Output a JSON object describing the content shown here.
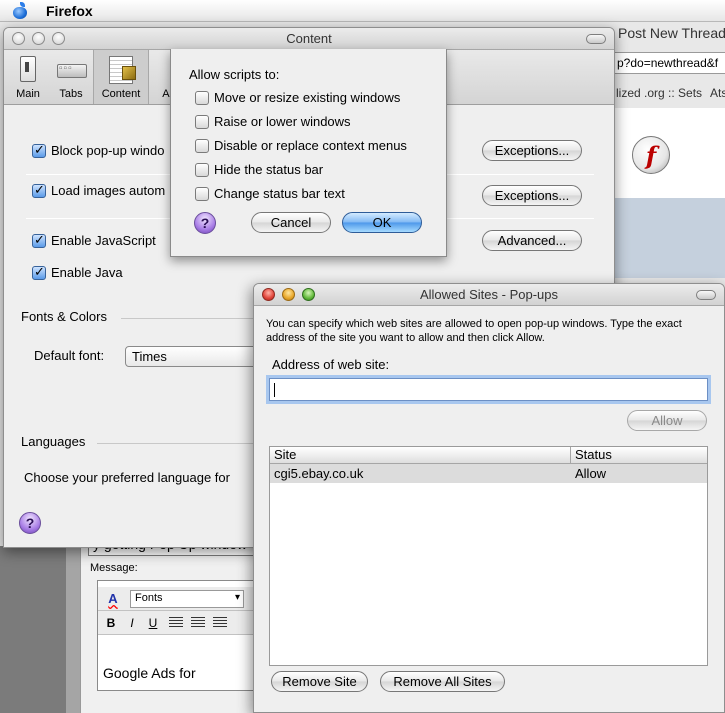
{
  "menubar": {
    "app_name": "Firefox"
  },
  "browser": {
    "title": "Post New Thread",
    "url": "p?do=newthread&f",
    "bookmarks": [
      "lized .org :: Sets",
      "Ats"
    ],
    "subject_value": "y getting Pop Up window",
    "message_label": "Message:",
    "editor": {
      "font_select": "Fonts",
      "bold": "B",
      "italic": "I",
      "underline": "U",
      "text": "Google Ads for"
    }
  },
  "prefs": {
    "title": "Content",
    "toolbar": [
      {
        "label": "Main",
        "icon": "main-switch-icon"
      },
      {
        "label": "Tabs",
        "icon": "tabs-icon"
      },
      {
        "label": "Content",
        "icon": "content-icon"
      },
      {
        "label": "Ap",
        "icon": "applications-icon"
      }
    ],
    "checks": {
      "block_popups": "Block pop-up windo",
      "load_images": "Load images autom",
      "enable_js": "Enable JavaScript",
      "enable_java": "Enable Java"
    },
    "buttons": {
      "exceptions1": "Exceptions...",
      "exceptions2": "Exceptions...",
      "advanced": "Advanced..."
    },
    "fonts_section": "Fonts & Colors",
    "default_font_label": "Default font:",
    "default_font_value": "Times",
    "languages_section": "Languages",
    "languages_desc": "Choose your preferred language for",
    "help": "?"
  },
  "scripts_sheet": {
    "heading": "Allow scripts to:",
    "options": [
      {
        "label": "Move or resize existing windows",
        "checked": false
      },
      {
        "label": "Raise or lower windows",
        "checked": false
      },
      {
        "label": "Disable or replace context menus",
        "checked": false
      },
      {
        "label": "Hide the status bar",
        "checked": false
      },
      {
        "label": "Change status bar text",
        "checked": false
      }
    ],
    "help": "?",
    "cancel": "Cancel",
    "ok": "OK"
  },
  "allowed_sites": {
    "title": "Allowed Sites - Pop-ups",
    "description": "You can specify which web sites are allowed to open pop-up windows. Type the exact address of the site you want to allow and then click Allow.",
    "address_label": "Address of web site:",
    "address_value": "",
    "allow_button": "Allow",
    "columns": {
      "site": "Site",
      "status": "Status"
    },
    "rows": [
      {
        "site": "cgi5.ebay.co.uk",
        "status": "Allow"
      }
    ],
    "remove_site": "Remove Site",
    "remove_all_sites": "Remove All Sites"
  }
}
